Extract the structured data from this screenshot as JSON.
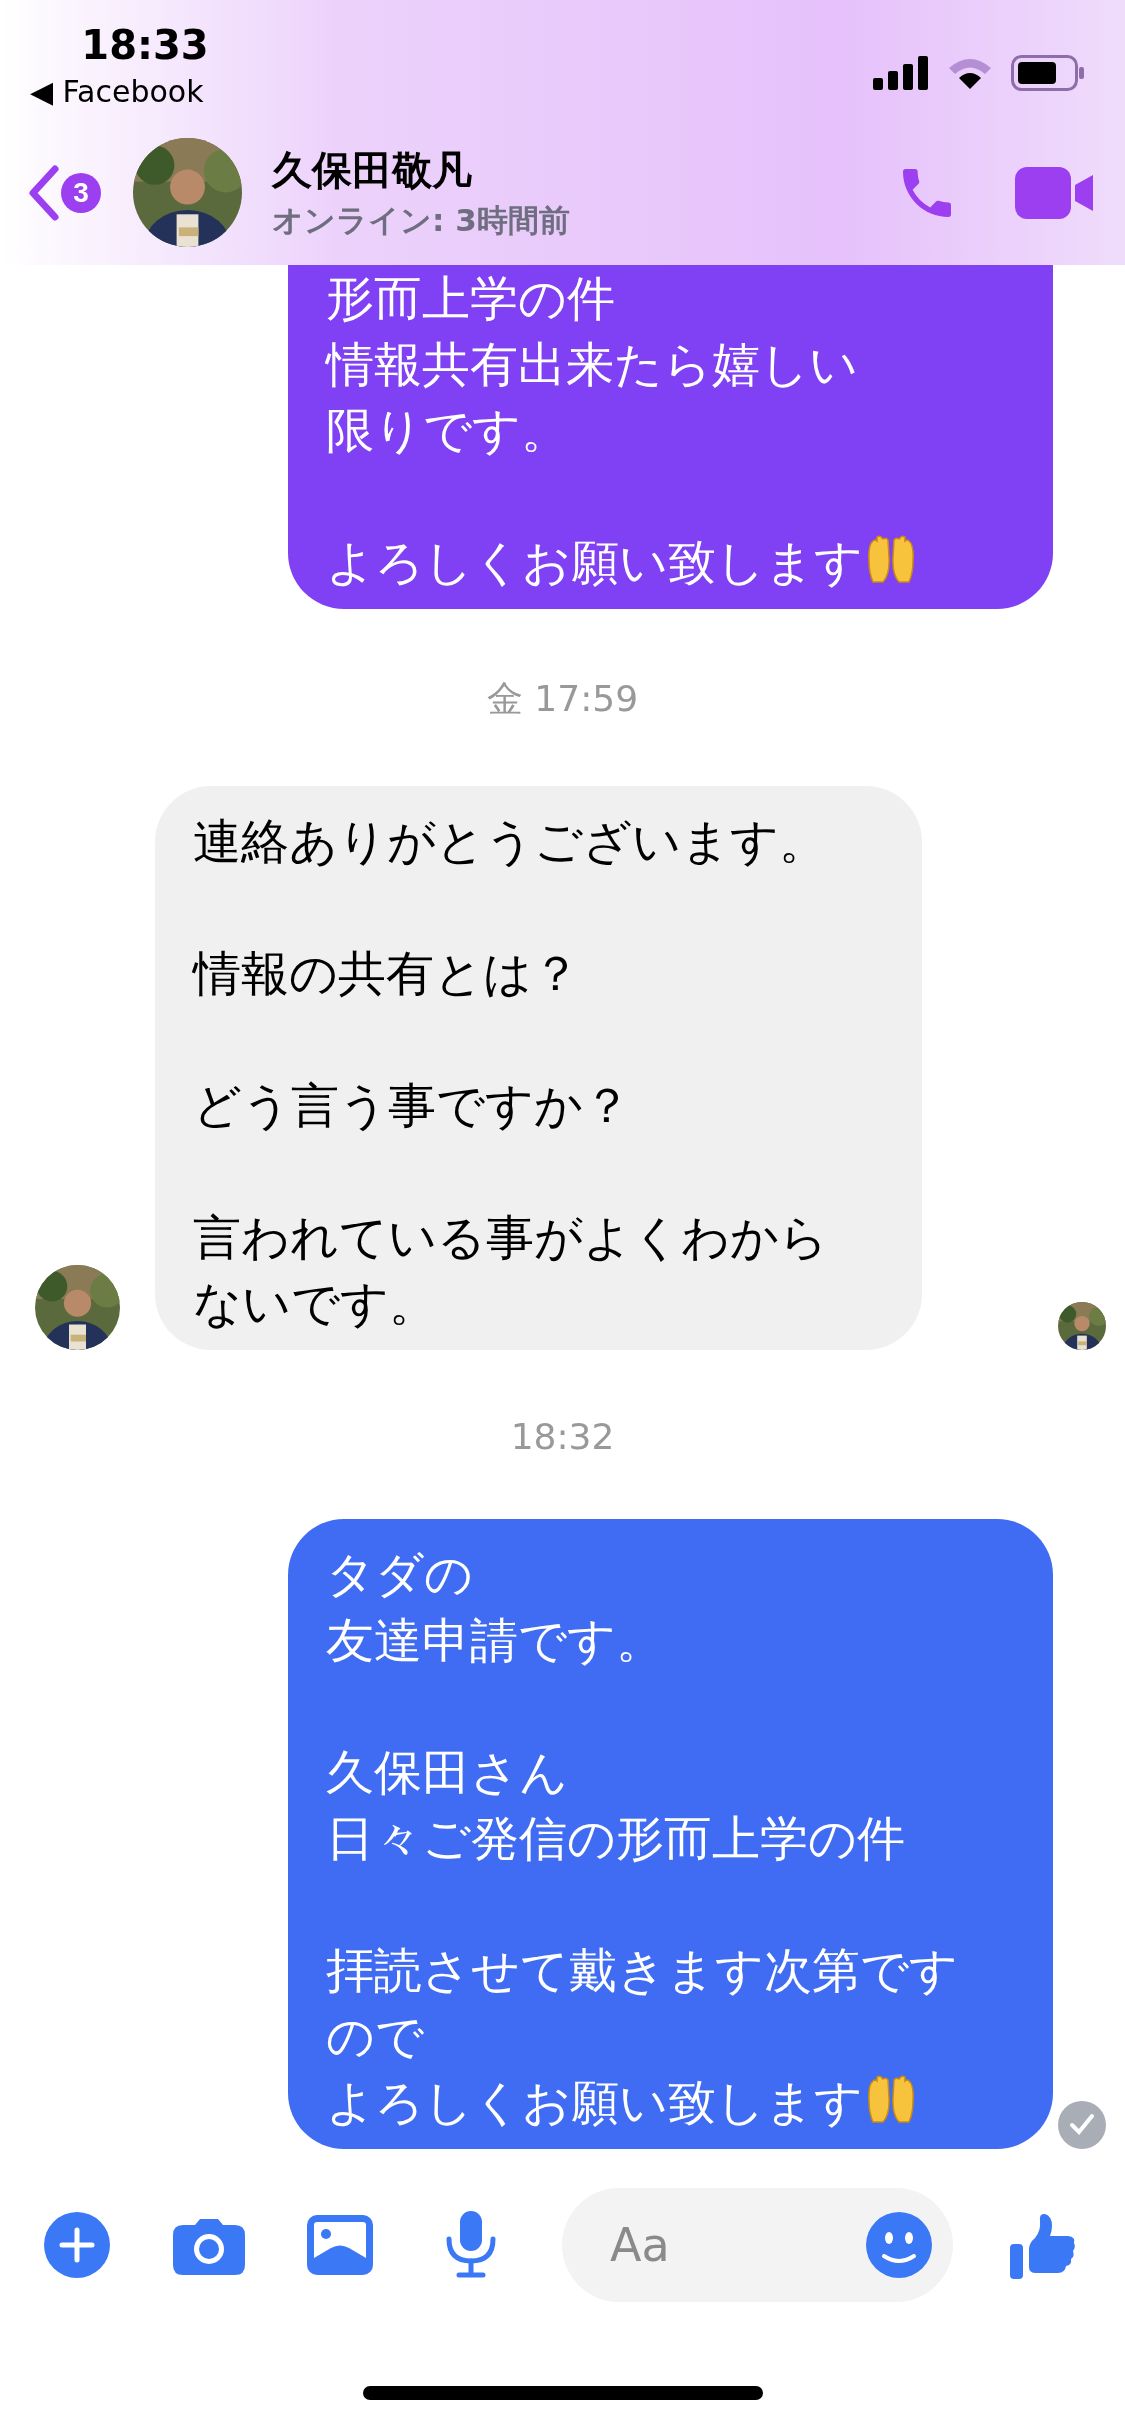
{
  "status_bar": {
    "time": "18:33",
    "back_app": "◀ Facebook"
  },
  "header": {
    "unread_count": "3",
    "name": "久保田敬凡",
    "status": "オンライン: 3時間前"
  },
  "messages": [
    {
      "kind": "outgoing",
      "color": "#8040f3",
      "cut_top": true,
      "paragraphs": [
        [
          {
            "text": "形而上学の件"
          },
          {
            "text": "情報共有出来たら嬉しい"
          },
          {
            "text": "限りです。"
          }
        ],
        [
          {
            "text": "よろしくお願い致します",
            "hands": true
          }
        ]
      ]
    },
    {
      "kind": "timestamp",
      "text": "金 17:59"
    },
    {
      "kind": "incoming",
      "avatar": true,
      "seen": true,
      "paragraphs": [
        [
          {
            "text": "連絡ありがとうございます。"
          }
        ],
        [
          {
            "text": "情報の共有とは？"
          }
        ],
        [
          {
            "text": "どう言う事ですか？"
          }
        ],
        [
          {
            "text": "言われている事がよくわから"
          },
          {
            "text": "ないです。"
          }
        ]
      ]
    },
    {
      "kind": "timestamp",
      "text": "18:32"
    },
    {
      "kind": "outgoing",
      "color": "#3f6cf3",
      "delivered": true,
      "paragraphs": [
        [
          {
            "text": "タダの"
          },
          {
            "text": "友達申請です。"
          }
        ],
        [
          {
            "text": "久保田さん"
          },
          {
            "text": "日々ご発信の形而上学の件"
          }
        ],
        [
          {
            "text": "拝読させて戴きます次第です"
          },
          {
            "text": "ので"
          },
          {
            "text": "よろしくお願い致します",
            "hands": true
          }
        ]
      ]
    }
  ],
  "composer": {
    "placeholder": "Aa"
  }
}
